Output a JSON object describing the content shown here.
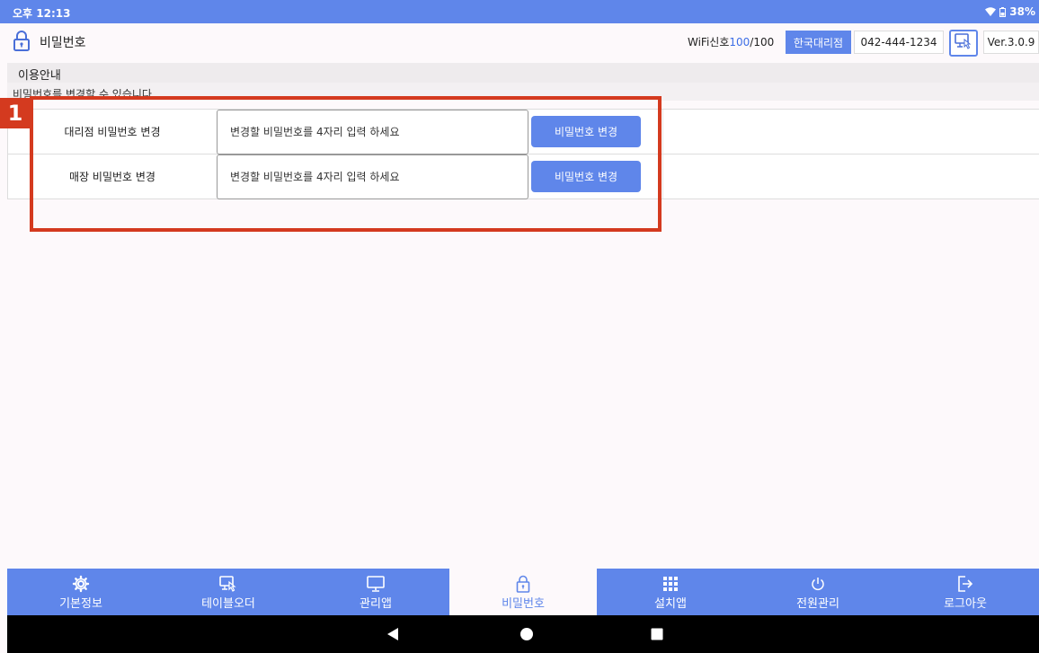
{
  "status_bar": {
    "time": "오후 12:13",
    "battery": "38%",
    "icons": [
      "wifi-icon",
      "battery-icon"
    ]
  },
  "app_bar": {
    "title": "비밀번호",
    "icon": "lock-icon",
    "wifi_prefix": "WiFi신호",
    "wifi_value": "100",
    "wifi_max": "/100",
    "dealer_name": "한국대리점",
    "dealer_phone": "042-444-1234",
    "sub_icon": "sub-monitor-icon",
    "version": "Ver.3.0.9"
  },
  "info": {
    "heading": "이용안내",
    "description": "비밀번호를 변경할 수 있습니다"
  },
  "password_rows": [
    {
      "label": "대리점 비밀번호 변경",
      "placeholder": "변경할 비밀번호를 4자리 입력 하세요",
      "button": "비밀번호 변경"
    },
    {
      "label": "매장 비밀번호 변경",
      "placeholder": "변경할 비밀번호를 4자리 입력 하세요",
      "button": "비밀번호 변경"
    }
  ],
  "annotation": {
    "badge": "1",
    "color": "#d43a1f"
  },
  "bottom_nav": {
    "active": "비밀번호",
    "items": [
      {
        "label": "기본정보",
        "icon": "gear-icon"
      },
      {
        "label": "테이블오더",
        "icon": "table-order-icon"
      },
      {
        "label": "관리앱",
        "icon": "monitor-icon"
      },
      {
        "label": "비밀번호",
        "icon": "lock-icon"
      },
      {
        "label": "설치앱",
        "icon": "apps-grid-icon"
      },
      {
        "label": "전원관리",
        "icon": "power-icon"
      },
      {
        "label": "로그아웃",
        "icon": "logout-icon"
      }
    ]
  },
  "system_nav": {
    "icons": [
      "back-icon",
      "home-icon",
      "recents-icon"
    ]
  },
  "colors": {
    "accent": "#5f86ea",
    "highlight": "#d43a1f",
    "wifi_value": "#3d6ee6"
  }
}
